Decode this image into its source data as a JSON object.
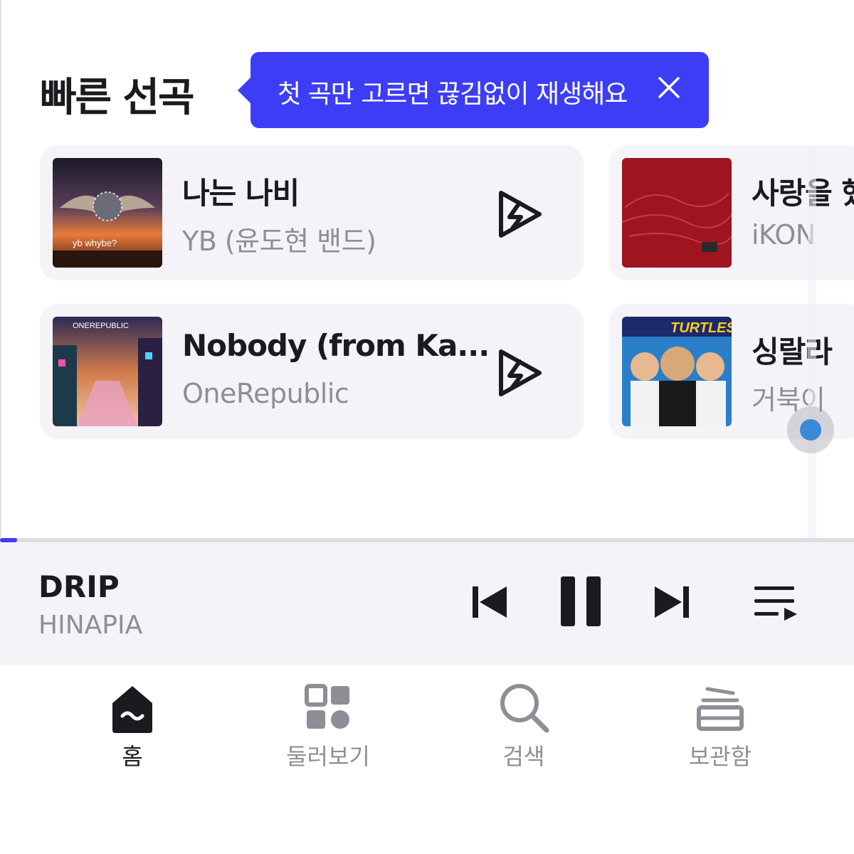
{
  "section": {
    "title": "빠른 선곡"
  },
  "tooltip": {
    "text": "첫 곡만 고르면 끊김없이 재생해요",
    "close_icon": "close-icon",
    "bg_color": "#3d3df5"
  },
  "quick_picks": [
    {
      "title": "나는 나비",
      "artist": "YB (윤도현 밴드)",
      "art_caption": "yb  whybe?"
    },
    {
      "title": "사랑을 했",
      "artist": "iKON"
    },
    {
      "title": "Nobody (from Ka...",
      "artist": "OneRepublic",
      "art_caption": "ONEREPUBLIC"
    },
    {
      "title": "싱랄라",
      "artist": "거북이",
      "art_caption": "TURTLES"
    }
  ],
  "player": {
    "title": "DRIP",
    "artist": "HINAPIA",
    "progress_percent": 2,
    "controls": [
      "previous-icon",
      "pause-icon",
      "next-icon",
      "queue-icon"
    ],
    "accent_color": "#3d3df5"
  },
  "nav": {
    "items": [
      {
        "label": "홈",
        "icon": "home-icon",
        "active": true
      },
      {
        "label": "둘러보기",
        "icon": "browse-icon",
        "active": false
      },
      {
        "label": "검색",
        "icon": "search-icon",
        "active": false
      },
      {
        "label": "보관함",
        "icon": "library-icon",
        "active": false
      }
    ]
  }
}
